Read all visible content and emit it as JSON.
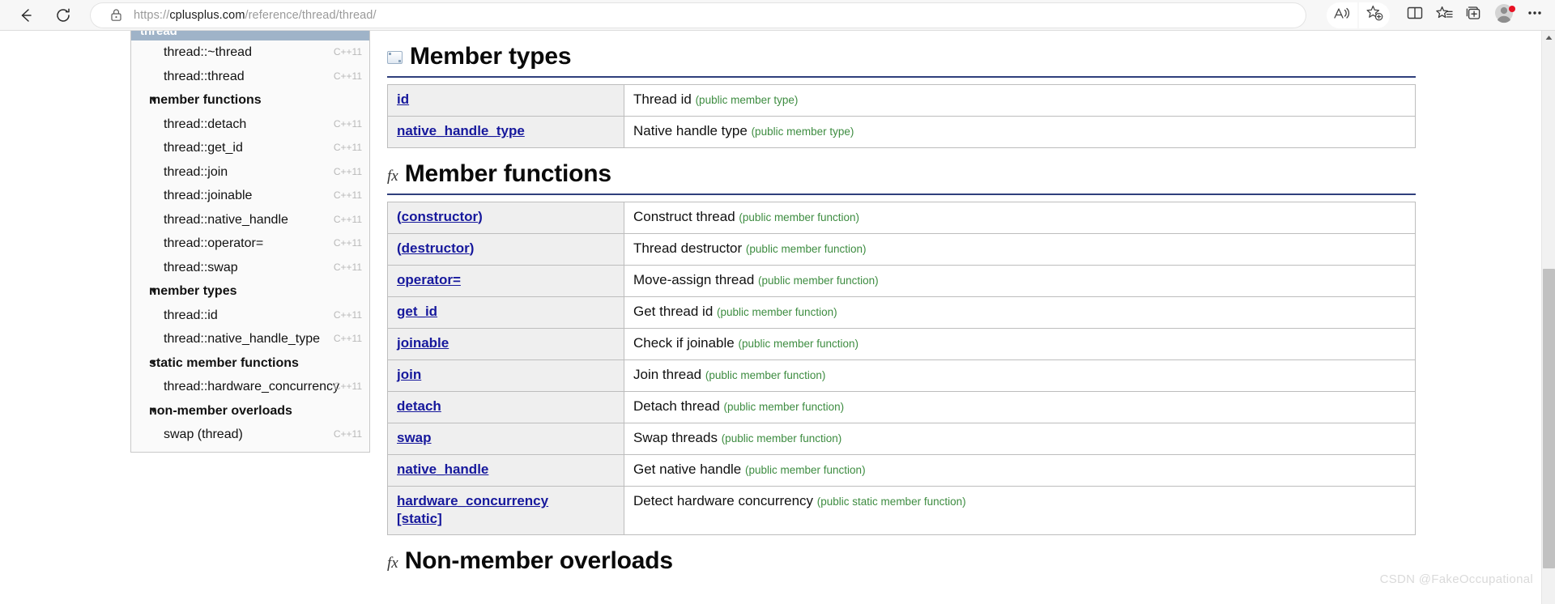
{
  "browser": {
    "back_label": "Back",
    "refresh_label": "Refresh",
    "url_prefix": "https://",
    "url_domain": "cplusplus.com",
    "url_path": "/reference/thread/thread/",
    "url_full": "https://cplusplus.com/reference/thread/thread/",
    "toolbar": {
      "read_aloud": "Read aloud",
      "add_favorite": "Add this page to favorites",
      "split_screen": "Split screen",
      "collections": "Collections",
      "browser_essentials": "Browser essentials",
      "profile": "Profile",
      "settings_more": "Settings and more"
    }
  },
  "sidebar": {
    "header": "thread",
    "items": [
      {
        "label": "thread::~thread",
        "version": "C++11",
        "type": "link",
        "indent": 1
      },
      {
        "label": "thread::thread",
        "version": "C++11",
        "type": "link",
        "indent": 1
      },
      {
        "label": "member functions",
        "version": "",
        "type": "group",
        "indent": 0
      },
      {
        "label": "thread::detach",
        "version": "C++11",
        "type": "link",
        "indent": 1
      },
      {
        "label": "thread::get_id",
        "version": "C++11",
        "type": "link",
        "indent": 1
      },
      {
        "label": "thread::join",
        "version": "C++11",
        "type": "link",
        "indent": 1
      },
      {
        "label": "thread::joinable",
        "version": "C++11",
        "type": "link",
        "indent": 1
      },
      {
        "label": "thread::native_handle",
        "version": "C++11",
        "type": "link",
        "indent": 1
      },
      {
        "label": "thread::operator=",
        "version": "C++11",
        "type": "link",
        "indent": 1
      },
      {
        "label": "thread::swap",
        "version": "C++11",
        "type": "link",
        "indent": 1
      },
      {
        "label": "member types",
        "version": "",
        "type": "group",
        "indent": 0
      },
      {
        "label": "thread::id",
        "version": "C++11",
        "type": "link",
        "indent": 1
      },
      {
        "label": "thread::native_handle_type",
        "version": "C++11",
        "type": "link",
        "indent": 1
      },
      {
        "label": "static member functions",
        "version": "",
        "type": "group",
        "indent": 0
      },
      {
        "label": "thread::hardware_concurrency",
        "version": "C++11",
        "type": "link",
        "indent": 1
      },
      {
        "label": "non-member overloads",
        "version": "",
        "type": "group",
        "indent": 0
      },
      {
        "label": "swap (thread)",
        "version": "C++11",
        "type": "link",
        "indent": 1
      }
    ],
    "caret_glyph": "▼"
  },
  "sections": [
    {
      "id": "member-types",
      "title": "Member types",
      "icon": "box-icon",
      "rows": [
        {
          "name": "id",
          "open_paren": "",
          "close_paren": "",
          "desc": "Thread id",
          "note": "(public member type)"
        },
        {
          "name": "native_handle_type",
          "open_paren": "",
          "close_paren": "",
          "desc": "Native handle type",
          "note": "(public member type)"
        }
      ]
    },
    {
      "id": "member-functions",
      "title": "Member functions",
      "icon": "fx-icon",
      "icon_text": "fx",
      "rows": [
        {
          "name": "constructor",
          "open_paren": "(",
          "close_paren": ")",
          "desc": "Construct thread",
          "note": "(public member function)"
        },
        {
          "name": "destructor",
          "open_paren": "(",
          "close_paren": ")",
          "desc": "Thread destructor",
          "note": "(public member function)"
        },
        {
          "name": "operator=",
          "open_paren": "",
          "close_paren": "",
          "desc": "Move-assign thread",
          "note": "(public member function)"
        },
        {
          "name": "get_id",
          "open_paren": "",
          "close_paren": "",
          "desc": "Get thread id",
          "note": "(public member function)"
        },
        {
          "name": "joinable",
          "open_paren": "",
          "close_paren": "",
          "desc": "Check if joinable",
          "note": "(public member function)"
        },
        {
          "name": "join",
          "open_paren": "",
          "close_paren": "",
          "desc": "Join thread",
          "note": "(public member function)"
        },
        {
          "name": "detach",
          "open_paren": "",
          "close_paren": "",
          "desc": "Detach thread",
          "note": "(public member function)"
        },
        {
          "name": "swap",
          "open_paren": "",
          "close_paren": "",
          "desc": "Swap threads",
          "note": "(public member function)"
        },
        {
          "name": "native_handle",
          "open_paren": "",
          "close_paren": "",
          "desc": "Get native handle",
          "note": "(public member function)"
        },
        {
          "name": "hardware_concurrency",
          "open_paren": "",
          "close_paren": "",
          "suffix": "[static]",
          "desc": "Detect hardware concurrency",
          "note": "(public static member function)"
        }
      ]
    },
    {
      "id": "non-member-overloads",
      "title": "Non-member overloads",
      "icon": "fx-icon",
      "icon_text": "fx",
      "rows": []
    }
  ],
  "scrollbar": {
    "up_arrow": "▲"
  },
  "watermark": "CSDN @FakeOccupational",
  "colors": {
    "link": "#16189c",
    "note_green": "#3d8c40",
    "rule_navy": "#2f3f7c",
    "sidebar_header_bg": "#9fb3c8",
    "cell_gray": "#efefef"
  }
}
